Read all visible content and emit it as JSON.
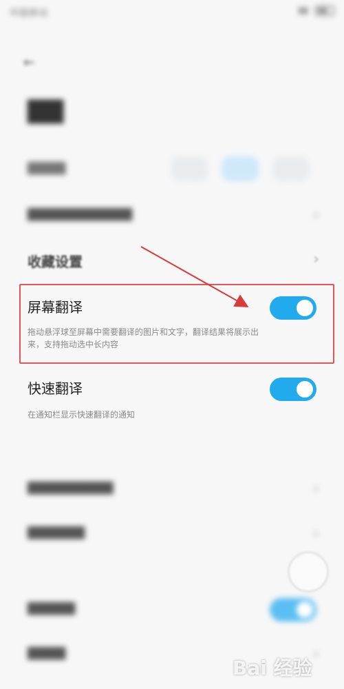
{
  "status_bar": {
    "left_text": "中国移动",
    "right_text": ""
  },
  "settings": {
    "favorite_label": "收藏设置",
    "screen_translate": {
      "title": "屏幕翻译",
      "description": "拖动悬浮球至屏幕中需要翻译的图片和文字，翻译结果将展示出来，支持拖动选中长内容",
      "enabled": true
    },
    "quick_translate": {
      "title": "快速翻译",
      "description": "在通知栏显示快速翻译的通知",
      "enabled": true
    }
  },
  "watermark": {
    "text": "Bai 经验"
  },
  "colors": {
    "accent": "#22aaee",
    "highlight": "#e25555"
  }
}
